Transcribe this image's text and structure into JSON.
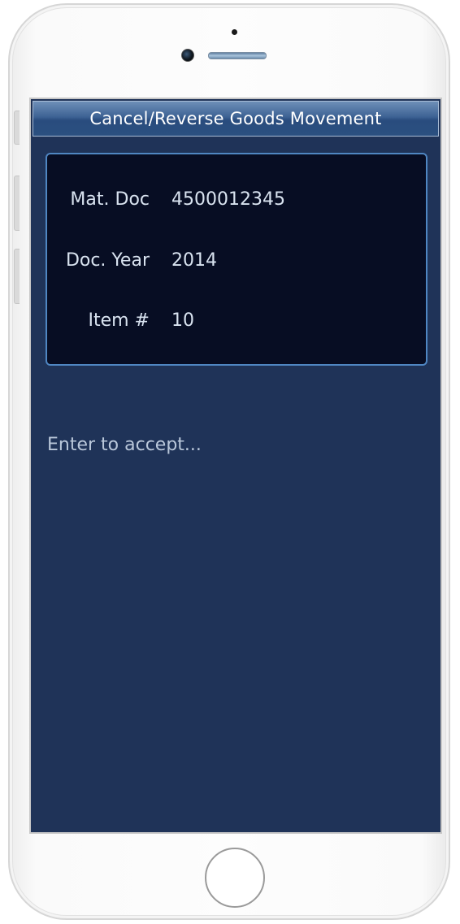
{
  "screen": {
    "title": "Cancel/Reverse Goods Movement",
    "fields": [
      {
        "label": "Mat. Doc",
        "value": "4500012345"
      },
      {
        "label": "Doc. Year",
        "value": "2014"
      },
      {
        "label": "Item #",
        "value": "10"
      }
    ],
    "prompt": "Enter to accept..."
  },
  "colors": {
    "screen_background": "#1f3358",
    "title_bar": "#2f5586",
    "panel_background": "#070d23",
    "panel_border": "#4f86c2",
    "text": "#d9e3f0"
  },
  "icons": [
    "camera-icon",
    "speaker-icon",
    "home-button-icon"
  ]
}
